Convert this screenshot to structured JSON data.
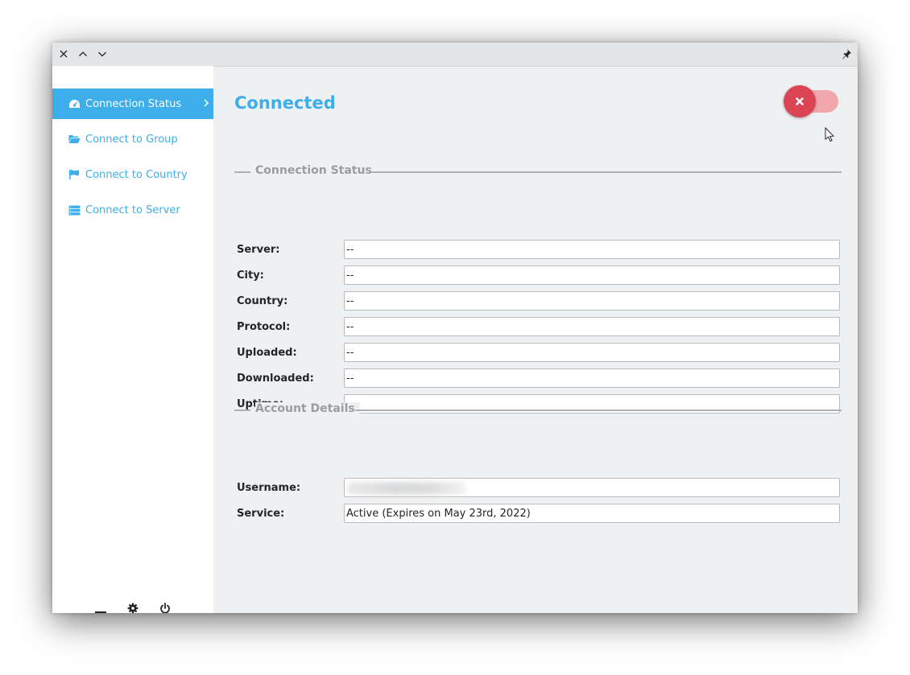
{
  "window": {
    "title": ""
  },
  "titlebar": {
    "buttons": [
      "close-icon",
      "maximize-icon",
      "minimize-icon"
    ],
    "pin_icon": "pin-icon"
  },
  "sidebar": {
    "items": [
      {
        "label": "Connection Status",
        "icon": "dashboard-icon",
        "active": true
      },
      {
        "label": "Connect to Group",
        "icon": "folder-open-icon",
        "active": false
      },
      {
        "label": "Connect to Country",
        "icon": "flag-icon",
        "active": false
      },
      {
        "label": "Connect to Server",
        "icon": "server-icon",
        "active": false
      }
    ],
    "footer_icons": [
      "minimize-bar-icon",
      "gear-icon",
      "power-icon"
    ]
  },
  "main": {
    "status_title": "Connected",
    "toggle": {
      "state": "on",
      "knob_icon": "close-x-icon"
    },
    "connection_section": {
      "title": "Connection Status",
      "fields": [
        {
          "label": "Server:",
          "value": "--"
        },
        {
          "label": "City:",
          "value": "--"
        },
        {
          "label": "Country:",
          "value": "--"
        },
        {
          "label": "Protocol:",
          "value": "--"
        },
        {
          "label": "Uploaded:",
          "value": "--"
        },
        {
          "label": "Downloaded:",
          "value": "--"
        },
        {
          "label": "Uptime:",
          "value": "--"
        }
      ]
    },
    "account_section": {
      "title": "Account Details",
      "fields": [
        {
          "label": "Username:",
          "value": "",
          "redacted": true
        },
        {
          "label": "Service:",
          "value": "Active (Expires on May 23rd, 2022)"
        }
      ]
    }
  },
  "colors": {
    "accent": "#3daee9",
    "danger": "#da4453",
    "toggle_track": "#f1a8ad",
    "panel_bg": "#eff0f1",
    "sidebar_bg": "#ffffff"
  }
}
